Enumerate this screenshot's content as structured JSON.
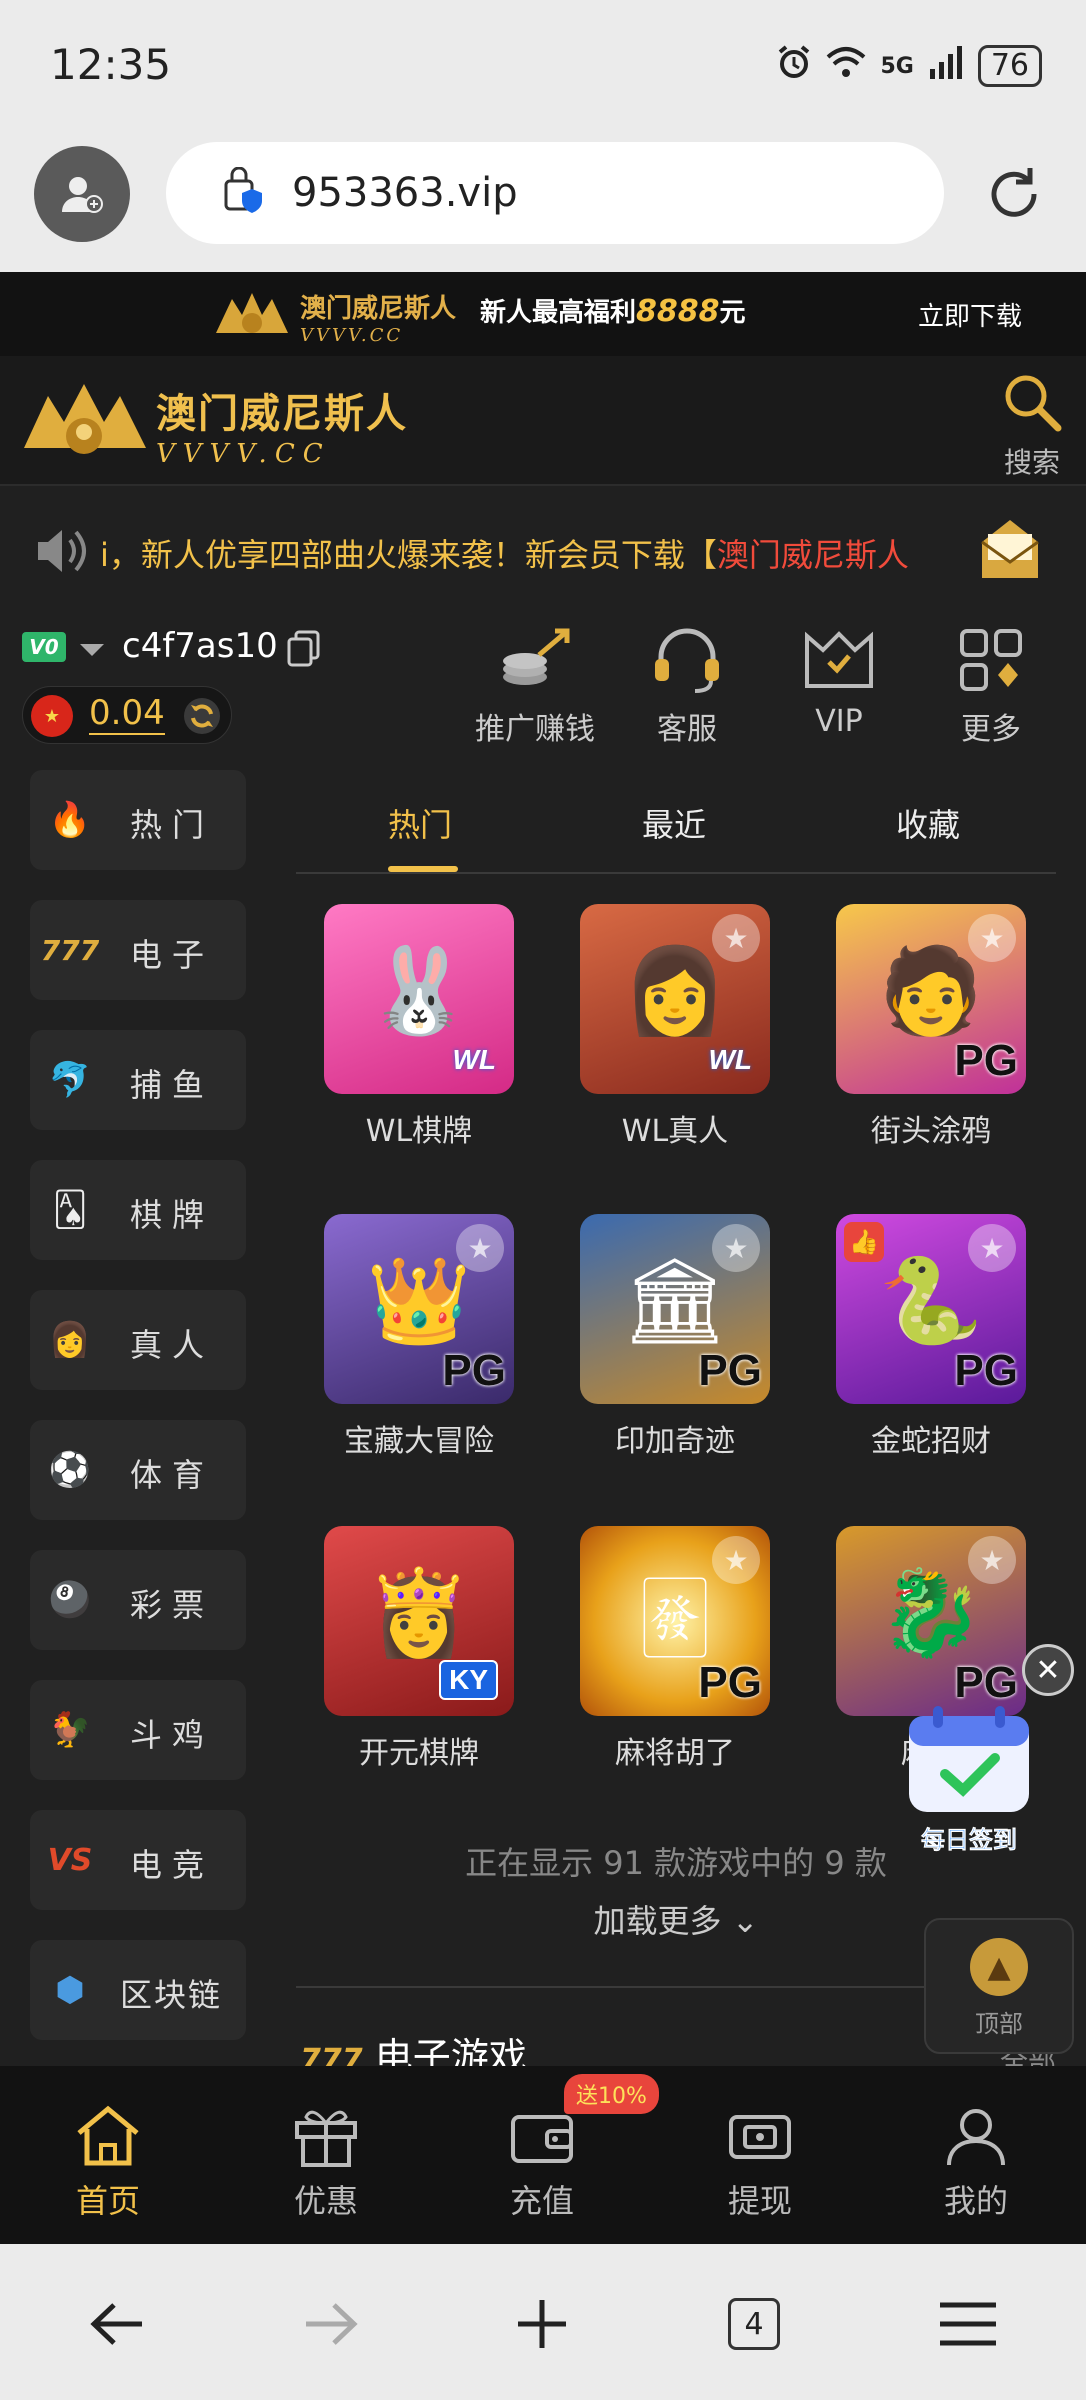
{
  "status": {
    "time": "12:35",
    "network": "5G",
    "battery": "76"
  },
  "browser": {
    "url": "953363.vip",
    "tab_count": "4"
  },
  "promo": {
    "logo_cn": "澳门威尼斯人",
    "logo_en": "VVVV.CC",
    "slogan_prefix": "新人最高福利",
    "slogan_amount": "8888",
    "slogan_suffix": "元",
    "download": "立即下载"
  },
  "header": {
    "brand_cn": "澳门威尼斯人",
    "brand_en": "VVVV.CC",
    "search_label": "搜索"
  },
  "marquee": {
    "text": "i，新人优享四部曲火爆来袭！新会员下载【",
    "highlight": "澳门威尼斯人"
  },
  "user": {
    "vip": "V0",
    "name": "c4f7as10",
    "balance": "0.04"
  },
  "quick_actions": [
    {
      "label": "推广赚钱",
      "icon": "promote-coins-icon"
    },
    {
      "label": "客服",
      "icon": "headset-icon"
    },
    {
      "label": "VIP",
      "icon": "vip-crown-icon"
    },
    {
      "label": "更多",
      "icon": "more-grid-icon"
    }
  ],
  "sidebar": [
    {
      "label": "热门",
      "icon": "fire-icon",
      "glyph": "🔥"
    },
    {
      "label": "电子",
      "icon": "slot-777-icon",
      "glyph": "777"
    },
    {
      "label": "捕鱼",
      "icon": "fish-icon",
      "glyph": "🐬"
    },
    {
      "label": "棋牌",
      "icon": "cards-icon",
      "glyph": "🂡"
    },
    {
      "label": "真人",
      "icon": "live-dealer-icon",
      "glyph": "👩"
    },
    {
      "label": "体育",
      "icon": "soccer-icon",
      "glyph": "⚽"
    },
    {
      "label": "彩票",
      "icon": "lottery-icon",
      "glyph": "🎱"
    },
    {
      "label": "斗鸡",
      "icon": "rooster-icon",
      "glyph": "🐓"
    },
    {
      "label": "电竞",
      "icon": "vs-esports-icon",
      "glyph": "VS"
    },
    {
      "label": "区块链",
      "icon": "blockchain-icon",
      "glyph": "⬢"
    }
  ],
  "tabs": [
    {
      "label": "热门",
      "active": true
    },
    {
      "label": "最近",
      "active": false
    },
    {
      "label": "收藏",
      "active": false
    }
  ],
  "games": [
    {
      "name": "WL棋牌",
      "badge": "WL",
      "bg": "#ee4fa3",
      "art": "🐰"
    },
    {
      "name": "WL真人",
      "badge": "WL",
      "bg": "#b8462e",
      "art": "👩"
    },
    {
      "name": "街头涂鸦",
      "badge": "PG",
      "bg": "#e8a11a",
      "art": "🧑"
    },
    {
      "name": "宝藏大冒险",
      "badge": "PG",
      "bg": "#6b4aa3",
      "art": "👑"
    },
    {
      "name": "印加奇迹",
      "badge": "PG",
      "bg": "#2a4a7a",
      "art": "🏛"
    },
    {
      "name": "金蛇招财",
      "badge": "PG",
      "bg": "#8a2fc9",
      "art": "🐍"
    },
    {
      "name": "开元棋牌",
      "badge": "KY",
      "bg": "#c92a2a",
      "art": "👸"
    },
    {
      "name": "麻将胡了",
      "badge": "PG",
      "bg": "#e8a11a",
      "art": "🀅"
    },
    {
      "name": "麻将",
      "badge": "PG",
      "bg": "#b57a1a",
      "art": "🐉"
    }
  ],
  "listing": {
    "showing": "正在显示 91 款游戏中的 9 款",
    "load_more": "加载更多"
  },
  "section": {
    "title": "电子游戏",
    "more": "全部"
  },
  "floating": {
    "checkin": "每日签到",
    "to_top": "顶部"
  },
  "bottom_nav": [
    {
      "label": "首页",
      "icon": "home-icon",
      "active": true
    },
    {
      "label": "优惠",
      "icon": "gift-icon",
      "active": false
    },
    {
      "label": "充值",
      "icon": "wallet-icon",
      "active": false
    },
    {
      "label": "提现",
      "icon": "withdraw-icon",
      "active": false
    },
    {
      "label": "我的",
      "icon": "profile-icon",
      "active": false
    }
  ],
  "bonus_badge": "送10%",
  "colors": {
    "accent_gold": "#f2c14a",
    "highlight_red": "#f14b3b",
    "bg_dark": "#202020"
  }
}
